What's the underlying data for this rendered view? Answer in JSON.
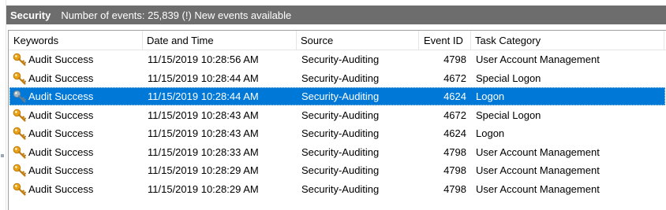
{
  "header": {
    "title": "Security",
    "status": "Number of events: 25,839 (!) New events available"
  },
  "columns": [
    "Keywords",
    "Date and Time",
    "Source",
    "Event ID",
    "Task Category"
  ],
  "rows": [
    {
      "keywords": "Audit Success",
      "datetime": "11/15/2019 10:28:56 AM",
      "source": "Security-Auditing",
      "event_id": "4798",
      "task": "User Account Management"
    },
    {
      "keywords": "Audit Success",
      "datetime": "11/15/2019 10:28:44 AM",
      "source": "Security-Auditing",
      "event_id": "4672",
      "task": "Special Logon"
    },
    {
      "keywords": "Audit Success",
      "datetime": "11/15/2019 10:28:44 AM",
      "source": "Security-Auditing",
      "event_id": "4624",
      "task": "Logon",
      "selected": true
    },
    {
      "keywords": "Audit Success",
      "datetime": "11/15/2019 10:28:43 AM",
      "source": "Security-Auditing",
      "event_id": "4672",
      "task": "Special Logon"
    },
    {
      "keywords": "Audit Success",
      "datetime": "11/15/2019 10:28:43 AM",
      "source": "Security-Auditing",
      "event_id": "4624",
      "task": "Logon"
    },
    {
      "keywords": "Audit Success",
      "datetime": "11/15/2019 10:28:33 AM",
      "source": "Security-Auditing",
      "event_id": "4798",
      "task": "User Account Management"
    },
    {
      "keywords": "Audit Success",
      "datetime": "11/15/2019 10:28:29 AM",
      "source": "Security-Auditing",
      "event_id": "4798",
      "task": "User Account Management"
    },
    {
      "keywords": "Audit Success",
      "datetime": "11/15/2019 10:28:29 AM",
      "source": "Security-Auditing",
      "event_id": "4798",
      "task": "User Account Management"
    }
  ],
  "row_icon": "key-icon",
  "colors": {
    "header_bar": "#6d6d6d",
    "selection": "#0078d7",
    "key_gold": "#e8a317"
  }
}
